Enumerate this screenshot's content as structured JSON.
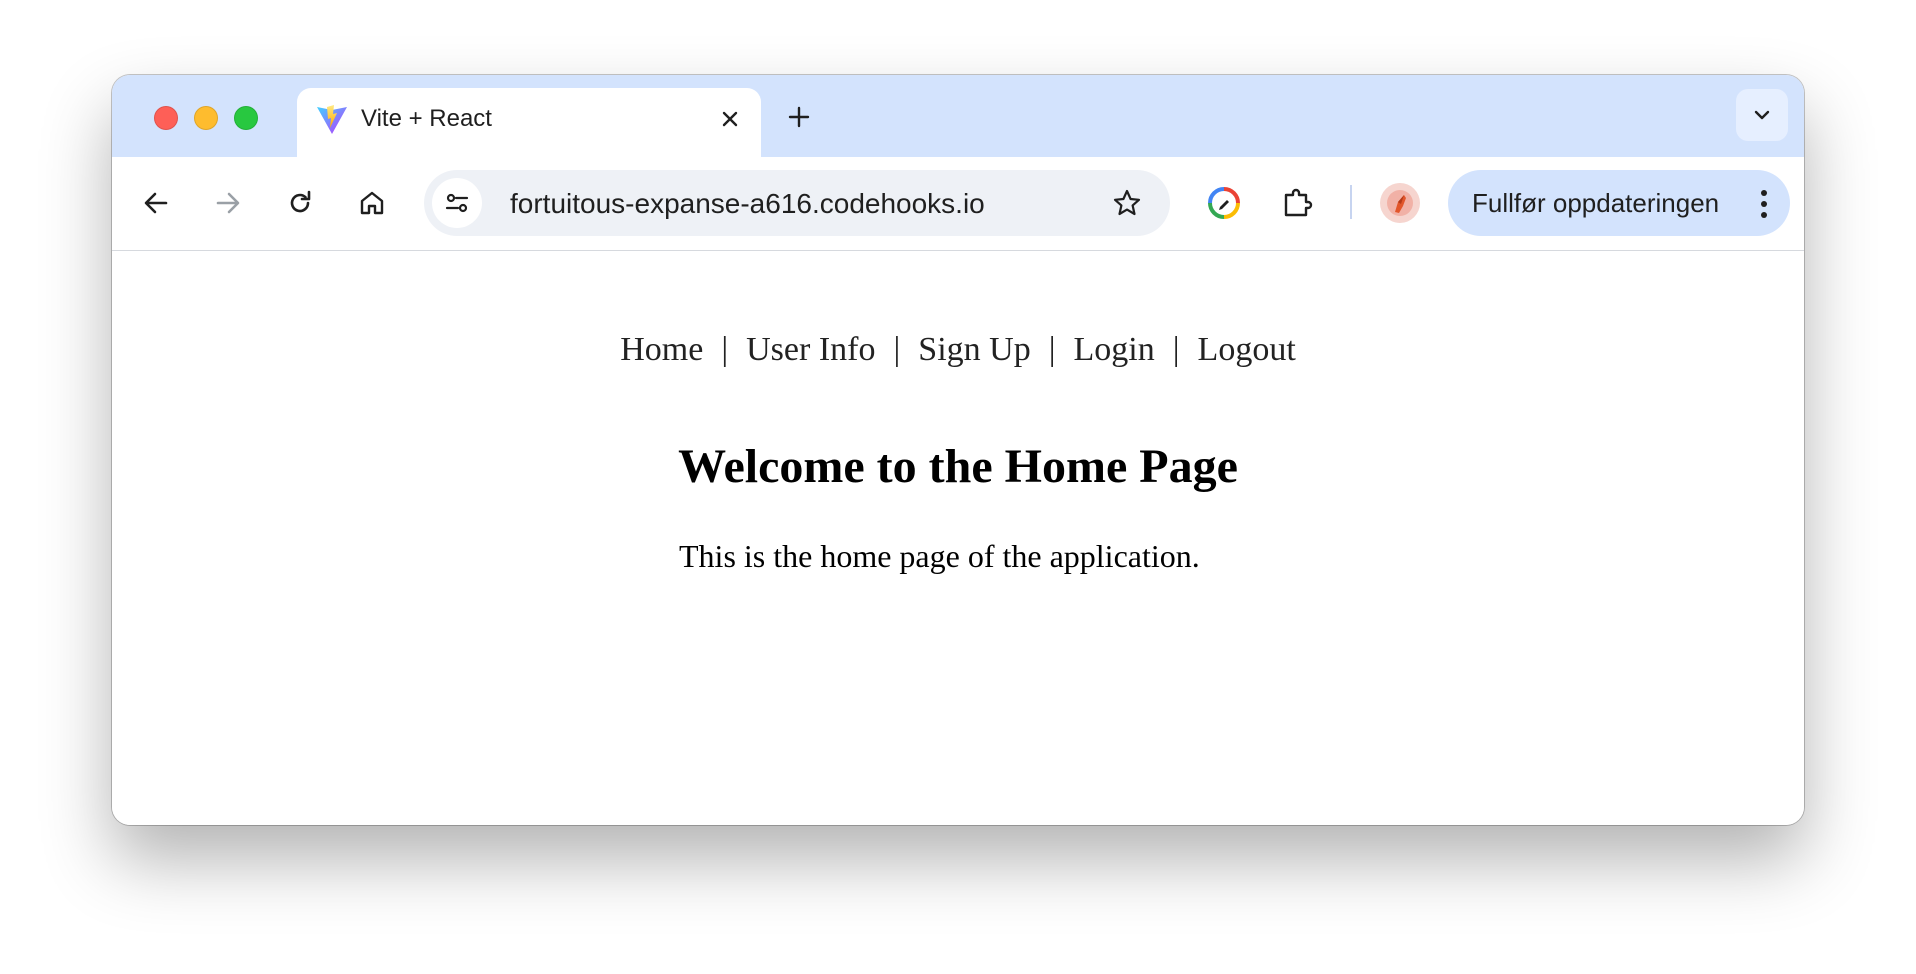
{
  "browser": {
    "tab": {
      "title": "Vite + React",
      "favicon": "vite-logo-icon"
    },
    "new_tab_symbol": "+",
    "toolbar": {
      "url": "fortuitous-expanse-a616.codehooks.io",
      "update_button_label": "Fullfør oppdateringen"
    },
    "icons": {
      "back": "arrow-left-icon",
      "forward": "arrow-right-icon",
      "reload": "reload-icon",
      "home": "home-icon",
      "site_info": "tune-icon",
      "bookmark": "star-icon",
      "lens": "google-lens-icon",
      "extensions": "puzzle-icon",
      "profile": "avatar",
      "menu": "vertical-dots-icon",
      "tab_search": "chevron-down-icon"
    },
    "colors": {
      "tabstrip": "#d3e3fd",
      "omnibox": "#eef1f6",
      "update_button": "#d3e3fd"
    }
  },
  "page": {
    "nav": [
      {
        "label": "Home"
      },
      {
        "label": "User Info"
      },
      {
        "label": "Sign Up"
      },
      {
        "label": "Login"
      },
      {
        "label": "Logout"
      }
    ],
    "nav_separator": "|",
    "heading": "Welcome to the Home Page",
    "paragraph": "This is the home page of the application."
  }
}
